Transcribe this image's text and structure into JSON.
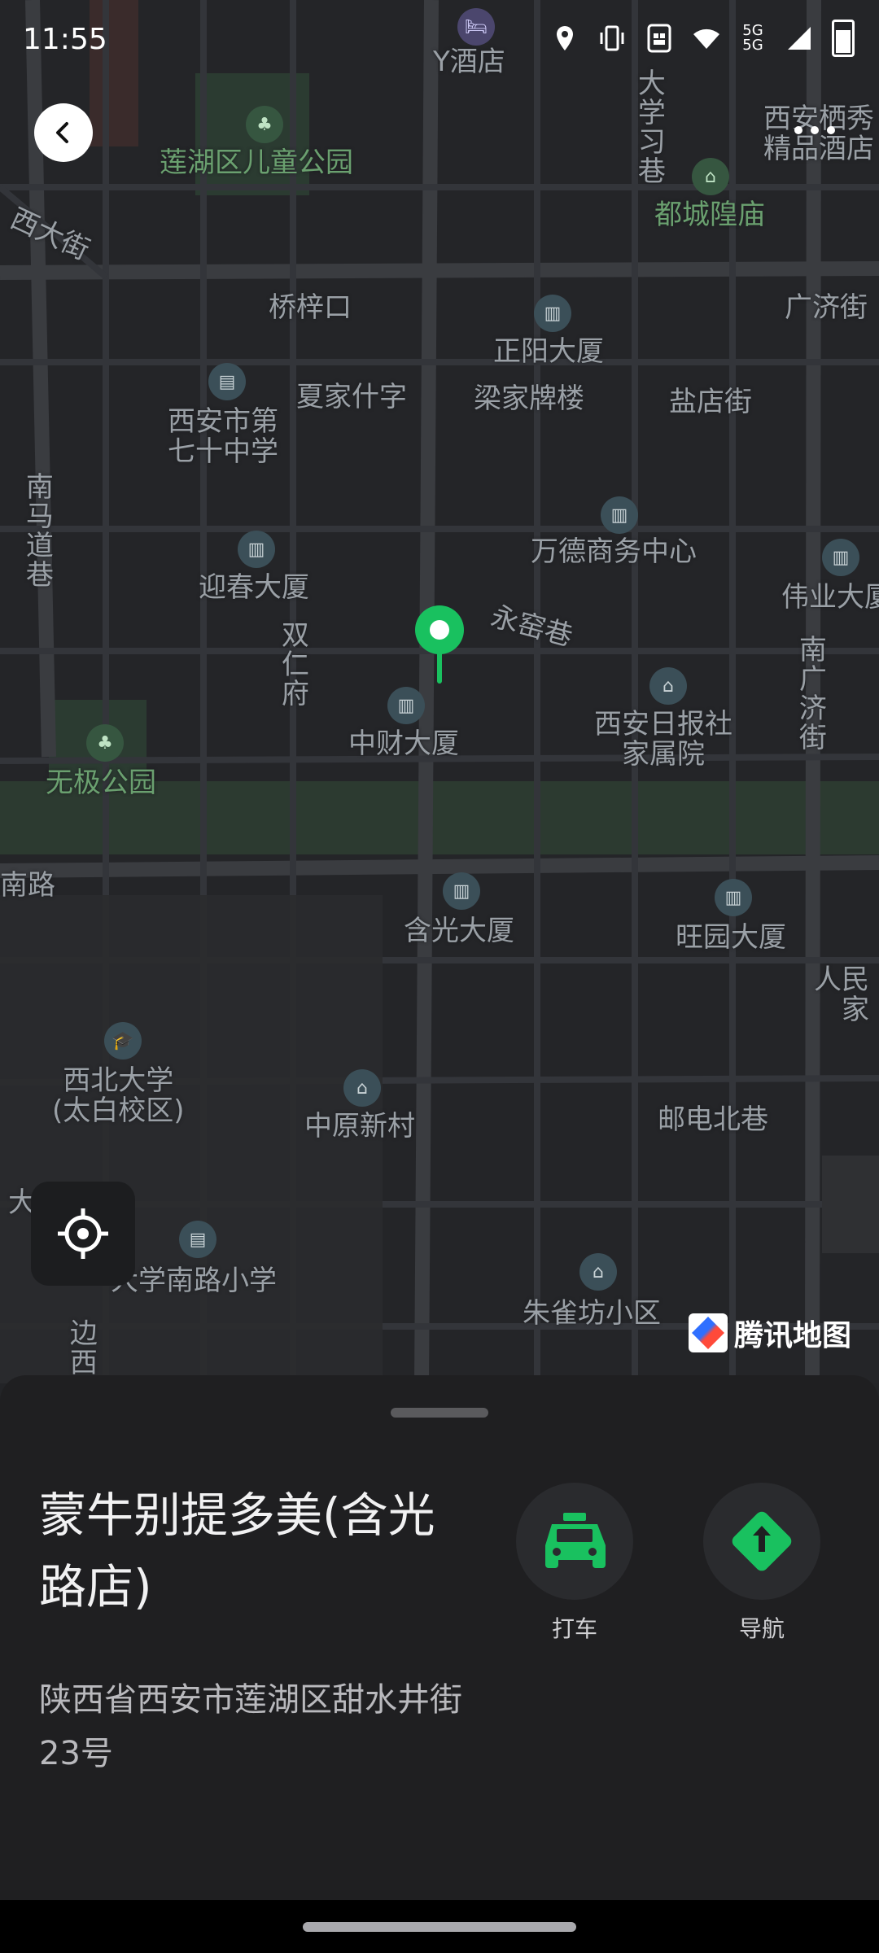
{
  "status_bar": {
    "time": "11:55",
    "icons": [
      "location-icon",
      "vibrate-icon",
      "sim-icon",
      "wifi-icon",
      "5g-signal-icon",
      "battery-icon"
    ],
    "network": "5G\n5G"
  },
  "map": {
    "labels": {
      "y_hotel": "Y酒店",
      "qiaozikou": "桥梓口",
      "guangjijie": "广济街",
      "xidajie": "西大街",
      "lianhu_park": "莲湖区儿童公园",
      "chenghuang": "都城隍庙",
      "daxuexixiang": "大学习巷",
      "xian_hotel": "西安栖秀\n精品酒店",
      "zhengyang": "正阳大厦",
      "xiajiashizi": "夏家什字",
      "liangjiapailou": "梁家牌楼",
      "yandianjie": "盐店街",
      "school70": "西安市第\n七十中学",
      "nanmadao": "南马道巷",
      "wande": "万德商务中心",
      "yingchun": "迎春大厦",
      "weiye": "伟业大厦",
      "yongyaoxiang": "永窑巷",
      "shuangrenfu": "双仁府",
      "nanguangji": "南广济街",
      "zhongcai": "中财大厦",
      "ribaoshe": "西安日报社\n家属院",
      "wuji_park": "无极公园",
      "nanlu": "南路",
      "hanguang": "含光大厦",
      "wangyuan": "旺园大厦",
      "renmin": "人民\n家",
      "xibei_univ": "西北大学\n(太白校区)",
      "zhongyuan": "中原新村",
      "youdian": "邮电北巷",
      "daxuenanlu": "大学南路小学",
      "zhuquefang": "朱雀坊小区",
      "bianxi": "边西",
      "da": "大"
    },
    "logo_text": "腾讯地图"
  },
  "buttons": {
    "back": "back",
    "more": "more"
  },
  "sheet": {
    "title": "蒙牛别提多美(含光路店)",
    "address": "陕西省西安市莲湖区甜水井街23号",
    "actions": [
      {
        "label": "打车",
        "icon": "taxi-icon",
        "color": "#19c15f"
      },
      {
        "label": "导航",
        "icon": "navigation-icon",
        "color": "#19c15f"
      }
    ]
  }
}
